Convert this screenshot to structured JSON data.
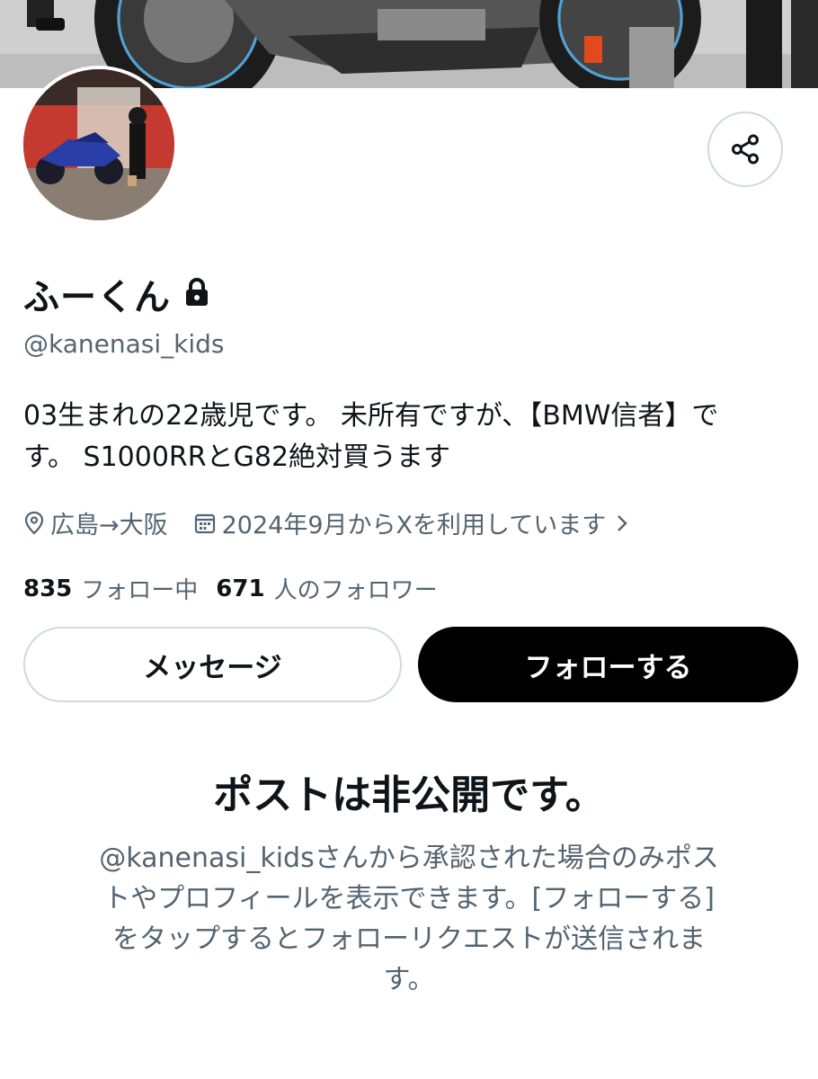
{
  "profile": {
    "display_name": "ふーくん",
    "handle": "@kanenasi_kids",
    "bio_line1": "03生まれの22歳児です。 未所有ですが、【BMW信者】で",
    "bio_line2": "す。 S1000RRとG82絶対買うます",
    "location": "広島→大阪",
    "joined": "2024年9月からXを利用しています",
    "following_count": "835",
    "following_label": "フォロー中",
    "followers_count": "671",
    "followers_label": "人のフォロワー"
  },
  "actions": {
    "message_label": "メッセージ",
    "follow_label": "フォローする"
  },
  "private_notice": {
    "title": "ポストは非公開です。",
    "line1": "@kanenasi_kidsさんから承認された場合のみポス",
    "line2": "トやプロフィールを表示できます。[フォローする]",
    "line3": "をタップするとフォローリクエストが送信されま",
    "line4": "す。"
  },
  "icons": {
    "share": "share-icon",
    "lock": "lock-icon",
    "location": "location-pin-icon",
    "calendar": "calendar-icon",
    "chevron": "chevron-right-icon"
  },
  "colors": {
    "text_primary": "#0f1419",
    "text_secondary": "#536471",
    "border": "#cfd9de",
    "follow_bg": "#000000"
  }
}
